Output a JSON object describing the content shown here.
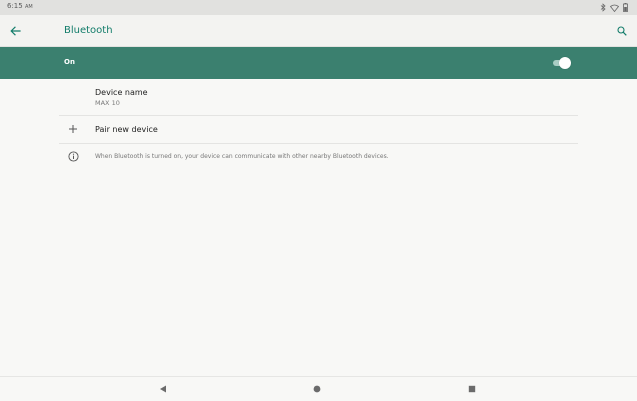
{
  "status_bar": {
    "time": "6:15",
    "ampm": "AM",
    "icons": [
      "bluetooth-icon",
      "wifi-icon",
      "battery-icon"
    ]
  },
  "app_bar": {
    "title": "Bluetooth",
    "back_icon": "arrow-back-icon",
    "search_icon": "search-icon"
  },
  "master_switch": {
    "label": "On",
    "checked": true
  },
  "device_name": {
    "title": "Device name",
    "summary": "MAX 10"
  },
  "pair_new_device": {
    "title": "Pair new device",
    "icon": "plus-icon"
  },
  "footer": {
    "text": "When Bluetooth is turned on, your device can communicate with other nearby Bluetooth devices.",
    "icon": "info-icon"
  },
  "colors": {
    "accent": "#127c6a",
    "switch_bar": "#3b806f",
    "background": "#f8f8f6"
  },
  "nav_bar": {
    "icons": [
      "nav-back-icon",
      "nav-home-icon",
      "nav-recents-icon"
    ]
  }
}
